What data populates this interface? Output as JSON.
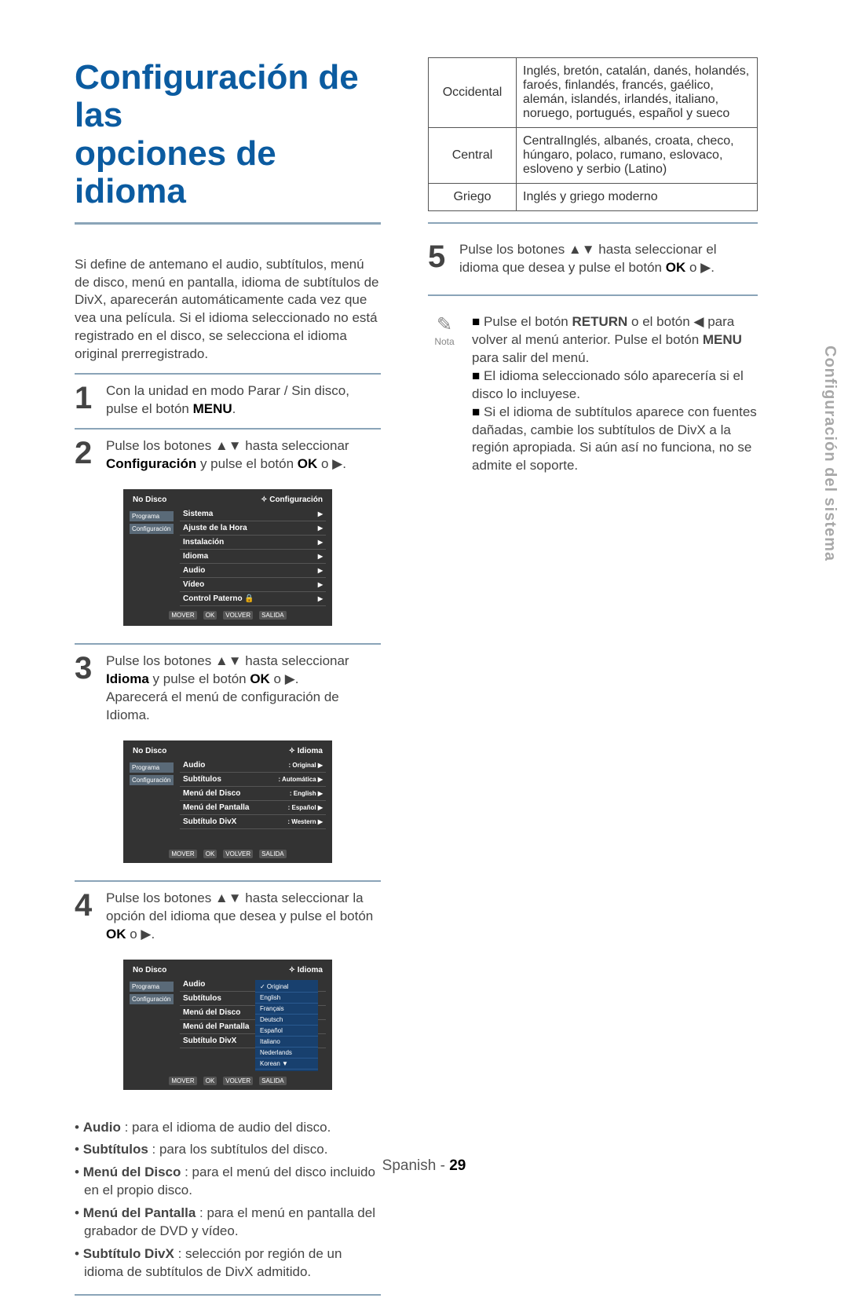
{
  "title_line1": "Configuración de las",
  "title_line2": "opciones de idioma",
  "intro": "Si define de antemano el audio, subtítulos, menú de disco, menú en pantalla, idioma de subtítulos de DivX, aparecerán automáticamente cada vez que vea una película. Si el idioma seleccionado no está registrado en el disco, se selecciona el idioma original prerregistrado.",
  "steps": {
    "s1": {
      "num": "1",
      "text_a": "Con la unidad en modo Parar / Sin disco, pulse el botón ",
      "bold": "MENU",
      "text_b": "."
    },
    "s2": {
      "num": "2",
      "text_a": "Pulse los botones ▲▼ hasta seleccionar ",
      "bold": "Configuración",
      "text_b": " y pulse el botón ",
      "bold2": "OK",
      "text_c": " o ▶."
    },
    "s3": {
      "num": "3",
      "text_a": "Pulse los botones ▲▼ hasta seleccionar ",
      "bold": "Idioma",
      "text_b": " y pulse el botón ",
      "bold2": "OK",
      "text_c": " o ▶.",
      "sub": "Aparecerá el menú de configuración de Idioma."
    },
    "s4": {
      "num": "4",
      "text_a": "Pulse los botones ▲▼ hasta seleccionar la opción del idioma que desea y pulse el botón ",
      "bold": "OK",
      "text_b": " o ▶."
    },
    "s5": {
      "num": "5",
      "text_a": "Pulse los botones ▲▼ hasta seleccionar el idioma que desea y pulse el botón ",
      "bold": "OK",
      "text_b": " o ▶."
    }
  },
  "osd1": {
    "title_l": "No Disco",
    "title_r": "✧ Configuración",
    "side": [
      "Programa",
      "Configuración"
    ],
    "items": [
      "Sistema",
      "Ajuste de la Hora",
      "Instalación",
      "Idioma",
      "Audio",
      "Vídeo",
      "Control Paterno  🔒"
    ],
    "foot": [
      "MOVER",
      "OK",
      "VOLVER",
      "SALIDA"
    ]
  },
  "osd2": {
    "title_l": "No Disco",
    "title_r": "✧ Idioma",
    "side": [
      "Programa",
      "Configuración"
    ],
    "rows": [
      {
        "l": "Audio",
        "r": ": Original"
      },
      {
        "l": "Subtítulos",
        "r": ": Automática"
      },
      {
        "l": "Menú del Disco",
        "r": ": English"
      },
      {
        "l": "Menú del Pantalla",
        "r": ": Español"
      },
      {
        "l": "Subtítulo DivX",
        "r": ": Western"
      }
    ],
    "foot": [
      "MOVER",
      "OK",
      "VOLVER",
      "SALIDA"
    ]
  },
  "osd3": {
    "title_l": "No Disco",
    "title_r": "✧ Idioma",
    "side": [
      "Programa",
      "Configuración"
    ],
    "left_items": [
      "Audio",
      "Subtítulos",
      "Menú del Disco",
      "Menú del Pantalla",
      "Subtítulo DivX"
    ],
    "popup": [
      "✓ Original",
      "English",
      "Français",
      "Deutsch",
      "Español",
      "Italiano",
      "Nederlands",
      "Korean    ▼"
    ],
    "foot": [
      "MOVER",
      "OK",
      "VOLVER",
      "SALIDA"
    ]
  },
  "bullets": [
    {
      "b": "Audio",
      "t": " : para el idioma de audio del disco."
    },
    {
      "b": "Subtítulos",
      "t": " : para los subtítulos del disco."
    },
    {
      "b": "Menú del Disco",
      "t": " : para el menú del disco incluido en el propio disco."
    },
    {
      "b": "Menú del Pantalla",
      "t": " : para el menú en pantalla del grabador de DVD y vídeo."
    },
    {
      "b": "Subtítulo DivX",
      "t": " : selección por región de un idioma de subtítulos de DivX admitido."
    }
  ],
  "lang_table": [
    {
      "h": "Occidental",
      "c": "Inglés, bretón, catalán, danés, holandés, faroés, finlandés, francés, gaélico, alemán, islandés, irlandés, italiano, noruego, portugués, español y sueco"
    },
    {
      "h": "Central",
      "c": "CentralInglés, albanés, croata, checo, húngaro, polaco, rumano, eslovaco, esloveno y serbio (Latino)"
    },
    {
      "h": "Griego",
      "c": "Inglés y griego moderno"
    }
  ],
  "note_label": "Nota",
  "notes": [
    {
      "pre": "Pulse el botón ",
      "b1": "RETURN",
      "mid": " o el botón ◀ para volver al menú anterior. Pulse el botón ",
      "b2": "MENU",
      "post": " para salir del menú."
    },
    {
      "plain": "El idioma seleccionado sólo aparecería si el disco lo incluyese."
    },
    {
      "plain": "Si el idioma de subtítulos aparece con fuentes dañadas, cambie los subtítulos de DivX a la región apropiada. Si aún así no funciona, no se admite el soporte."
    }
  ],
  "side_label": "Configuración del sistema",
  "footer_a": "Spanish - ",
  "footer_b": "29"
}
